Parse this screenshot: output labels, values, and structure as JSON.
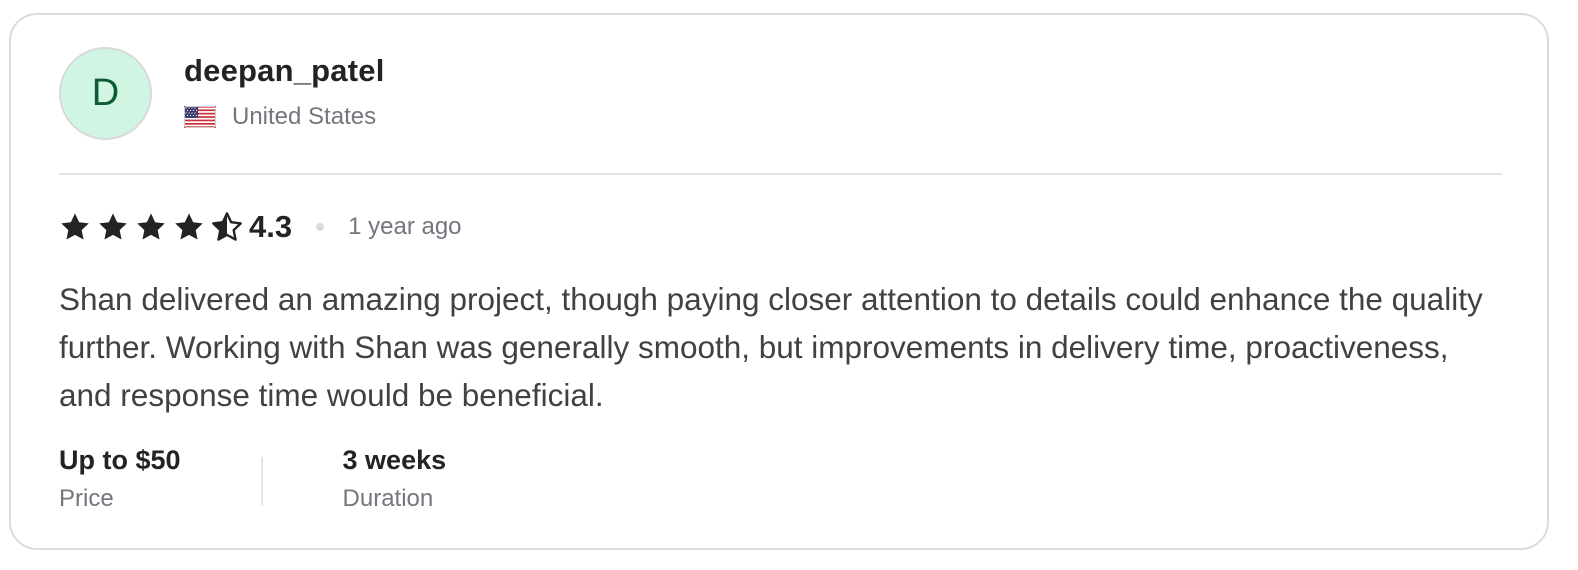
{
  "review": {
    "avatar_initial": "D",
    "username": "deepan_patel",
    "country": "United States",
    "flag_icon": "us-flag-icon",
    "rating": 4.3,
    "rating_text": "4.3",
    "time_ago": "1 year ago",
    "text": "Shan delivered an amazing project, though paying closer attention to details could enhance the quality further. Working with Shan was generally smooth, but improvements in delivery time, proactiveness, and response time would be beneficial.",
    "price": {
      "value": "Up to $50",
      "label": "Price"
    },
    "duration": {
      "value": "3 weeks",
      "label": "Duration"
    }
  },
  "colors": {
    "avatar_bg": "#d1f5e3",
    "avatar_text": "#0c5b32",
    "star": "#222325",
    "muted_text": "#74767e",
    "border": "#dadbdd"
  }
}
